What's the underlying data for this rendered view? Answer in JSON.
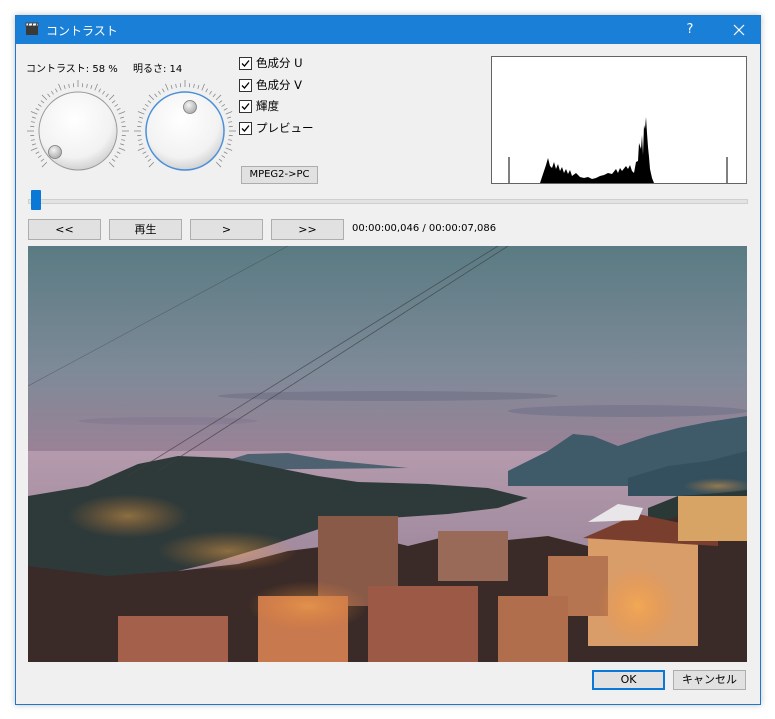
{
  "window": {
    "title": "コントラスト",
    "help": "?"
  },
  "controls": {
    "contrast_label": "コントラスト: 58 %",
    "brightness_label": "明るさ: 14",
    "checkboxes": [
      {
        "label": "色成分 U",
        "checked": true
      },
      {
        "label": "色成分 V",
        "checked": true
      },
      {
        "label": "輝度",
        "checked": true
      },
      {
        "label": "プレビュー",
        "checked": true
      }
    ],
    "mpeg_button": "MPEG2->PC"
  },
  "playback": {
    "prev_label": "<<",
    "play_label": "再生",
    "next_label": ">",
    "fast_label": ">>",
    "timecode": "00:00:00,046 / 00:00:07,086",
    "position_fraction": 0.006
  },
  "footer": {
    "ok_label": "OK",
    "cancel_label": "キャンセル"
  },
  "colors": {
    "titlebar": "#1a7fd6",
    "accent": "#0a78d7"
  }
}
